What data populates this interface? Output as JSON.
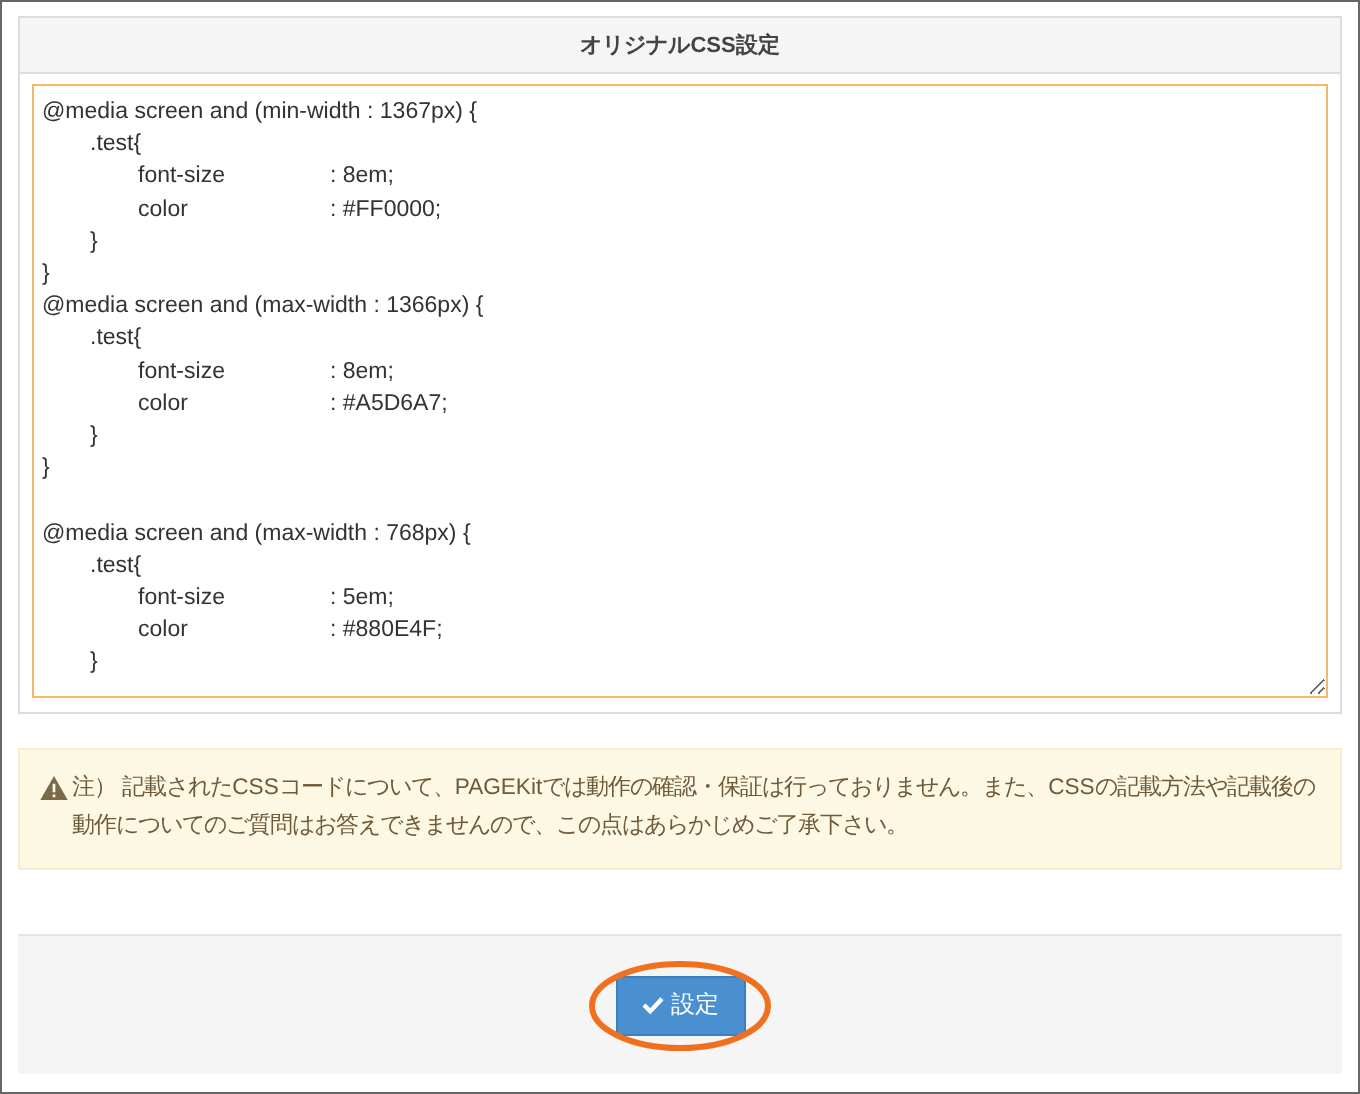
{
  "panel": {
    "title": "オリジナルCSS設定"
  },
  "css_editor": {
    "value": "@media screen and (min-width : 1367px) {\n\t.test{\n\t\tfont-size\t\t\t: 8em;\n\t\tcolor\t\t\t: #FF0000;\n\t}\n}\n@media screen and (max-width : 1366px) {\n\t.test{\n\t\tfont-size\t\t\t: 8em;\n\t\tcolor\t\t\t: #A5D6A7;\n\t}\n}\n\n@media screen and (max-width : 768px) {\n\t.test{\n\t\tfont-size\t\t\t: 5em;\n\t\tcolor\t\t\t: #880E4F;\n\t}"
  },
  "notice": {
    "text": "注） 記載されたCSSコードについて、PAGEKitでは動作の確認・保証は行っておりません。また、CSSの記載方法や記載後の動作についてのご質問はお答えできませんので、この点はあらかじめご了承下さい。"
  },
  "submit_button": {
    "label": "設定",
    "highlighted": true
  }
}
